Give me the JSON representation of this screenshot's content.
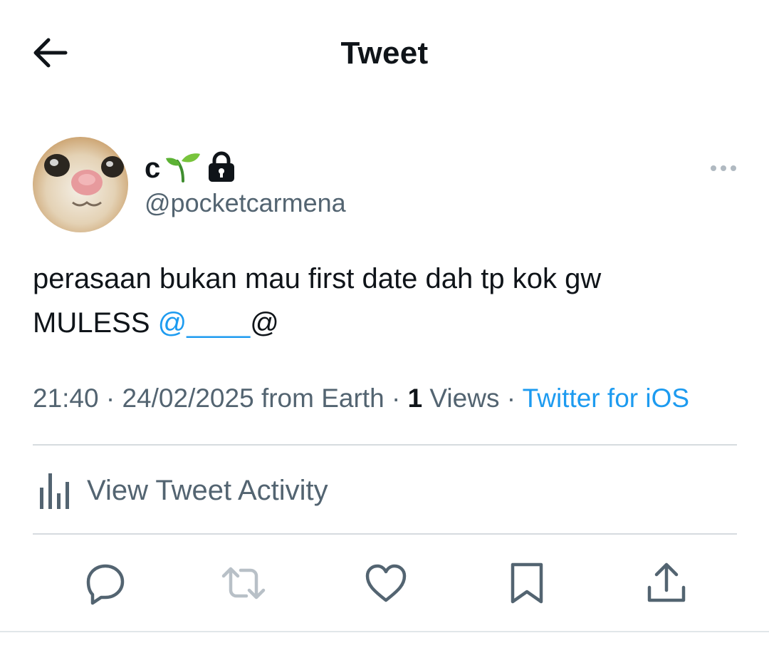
{
  "header": {
    "title": "Tweet",
    "back_icon": "arrow-left-icon"
  },
  "tweet": {
    "author": {
      "name": "c",
      "name_emoji": "🌱",
      "locked_icon": "lock-icon",
      "handle": "@pocketcarmena",
      "avatar_description_icon": "cat-avatar"
    },
    "text_line1": "perasaan bukan mau first date dah tp kok gw",
    "text_line2_prefix": "MULESS ",
    "text_mention": "@____",
    "text_line2_suffix": "@",
    "meta": {
      "time": "21:40",
      "sep1": " · ",
      "date": "24/02/2025",
      "location": " from Earth",
      "sep2": " · ",
      "views_count": "1",
      "views_label": " Views",
      "sep3": " · ",
      "source": "Twitter for iOS"
    },
    "activity_label": "View Tweet Activity"
  },
  "actions": [
    "reply-icon",
    "retweet-icon",
    "like-icon",
    "bookmark-icon",
    "share-icon"
  ],
  "colors": {
    "link": "#1d9bf0",
    "secondary": "#536471",
    "primary": "#0f1419",
    "divider": "#d6dbdf"
  }
}
